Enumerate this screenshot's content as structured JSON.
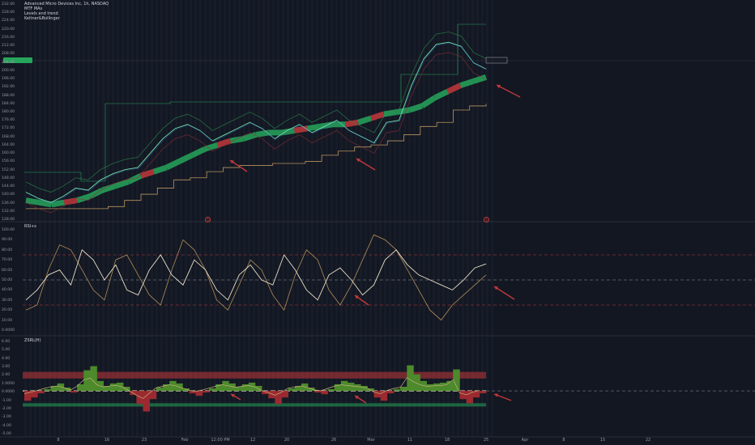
{
  "header": {
    "title": "Advanced Micro Devices Inc, 1h, NASDAQ",
    "lines": [
      "MTF MAs",
      "Levels and trend",
      "Keltner&Bollinger"
    ]
  },
  "price_axis": {
    "labels": [
      "232.00",
      "228.00",
      "224.00",
      "220.00",
      "216.00",
      "212.00",
      "208.00",
      "204.00",
      "200.00",
      "196.00",
      "192.00",
      "188.00",
      "184.00",
      "180.00",
      "176.00",
      "172.00",
      "168.00",
      "164.00",
      "160.00",
      "156.00",
      "152.00",
      "148.00",
      "144.00",
      "140.00",
      "136.00",
      "132.00",
      "128.00"
    ],
    "current_price": ""
  },
  "rsi_pane": {
    "title": "RSI+s",
    "labels": [
      "100.00",
      "90.00",
      "80.00",
      "70.00",
      "60.00",
      "50.00",
      "40.00",
      "30.00",
      "20.00",
      "10.00",
      "0.0000"
    ]
  },
  "zsrl_pane": {
    "title": "ZSRL(H)",
    "labels": [
      "6.00",
      "5.00",
      "4.00",
      "3.00",
      "2.00",
      "1.0000",
      "0.0000",
      "-1.00",
      "-2.00",
      "-3.00",
      "-4.00",
      "-5.00"
    ]
  },
  "time_axis": {
    "labels": [
      "8",
      "16",
      "23",
      "Feb",
      "12:00 PM",
      "12",
      "20",
      "26",
      "Mar",
      "11",
      "18",
      "25",
      "Apr",
      "8",
      "15",
      "22"
    ]
  },
  "markers": [
    "S",
    "S"
  ],
  "colors": {
    "background": "#131722",
    "bull": "#26a65b",
    "bear": "#c2393b",
    "rsi_main": "#e8e0c8",
    "rsi_signal": "#b08d57",
    "level_line": "#b8945e"
  },
  "chart_data": [
    {
      "type": "line",
      "pane": "price",
      "ylim": [
        128,
        232
      ],
      "ma_price": [
        136,
        135,
        134,
        135,
        136,
        138,
        141,
        143,
        145,
        148,
        150,
        152,
        155,
        158,
        161,
        163,
        165,
        166,
        168,
        169,
        169,
        170,
        171,
        172,
        173,
        173,
        174,
        176,
        178,
        179,
        180,
        182,
        186,
        189,
        192,
        194,
        196
      ],
      "price": [
        140,
        137,
        135,
        138,
        142,
        141,
        146,
        149,
        151,
        152,
        159,
        166,
        171,
        173,
        170,
        165,
        168,
        171,
        174,
        171,
        166,
        170,
        173,
        169,
        172,
        175,
        170,
        167,
        164,
        174,
        175,
        192,
        205,
        212,
        213,
        211,
        203,
        200
      ],
      "levels_lower": [
        132,
        132,
        135,
        140,
        142,
        150,
        152,
        156,
        160,
        162,
        163,
        165,
        170,
        170,
        165,
        167,
        170,
        165,
        163,
        170,
        170,
        174,
        176,
        176,
        178,
        180
      ],
      "levels_support": [
        132,
        132,
        132,
        132,
        132,
        133,
        136,
        139,
        142,
        146,
        147,
        150,
        152,
        153,
        153,
        154,
        154,
        155,
        158,
        160,
        162,
        163,
        165,
        168,
        172,
        174,
        180,
        182,
        183
      ]
    },
    {
      "type": "line",
      "pane": "rsi",
      "ylim": [
        0,
        100
      ],
      "thresholds": [
        75,
        50,
        25
      ],
      "values": [
        30,
        40,
        55,
        60,
        45,
        80,
        70,
        50,
        65,
        40,
        35,
        60,
        75,
        55,
        45,
        70,
        60,
        40,
        30,
        55,
        65,
        50,
        45,
        75,
        60,
        40,
        30,
        55,
        62,
        50,
        35,
        45,
        70,
        80,
        65,
        55,
        50,
        45,
        40,
        50,
        62,
        66
      ],
      "signal": [
        20,
        25,
        60,
        85,
        80,
        60,
        40,
        30,
        70,
        75,
        55,
        35,
        25,
        60,
        90,
        80,
        60,
        30,
        20,
        45,
        70,
        60,
        35,
        20,
        55,
        80,
        70,
        40,
        25,
        45,
        70,
        95,
        90,
        80,
        60,
        40,
        20,
        10,
        25,
        35,
        45,
        55
      ]
    },
    {
      "type": "bar",
      "pane": "zsrl",
      "ylim": [
        -5,
        6
      ],
      "bands": {
        "upper": [
          1.5,
          2.0
        ],
        "lower": [
          -1.5,
          -1.0
        ]
      },
      "values": [
        -1.2,
        -0.8,
        -0.3,
        0.2,
        0.6,
        0.9,
        0.4,
        -0.2,
        0.8,
        2.5,
        3.0,
        1.2,
        0.6,
        0.9,
        1.0,
        0.5,
        -0.5,
        -1.6,
        -2.5,
        -1.0,
        0.4,
        0.8,
        1.2,
        0.9,
        0.3,
        -0.3,
        -0.6,
        -0.2,
        0.3,
        0.8,
        1.2,
        0.9,
        0.5,
        0.8,
        1.0,
        0.6,
        -0.4,
        -0.9,
        -1.6,
        -0.8,
        0.3,
        0.6,
        0.9,
        0.4,
        -0.2,
        -0.4,
        0.2,
        0.8,
        1.2,
        1.0,
        0.8,
        0.6,
        0.3,
        -0.8,
        -1.2,
        -0.3,
        0.2,
        0.5,
        3.1,
        2.0,
        1.2,
        0.8,
        0.9,
        1.0,
        1.2,
        2.6,
        -1.0,
        -1.5,
        -0.8,
        -0.3
      ]
    }
  ]
}
